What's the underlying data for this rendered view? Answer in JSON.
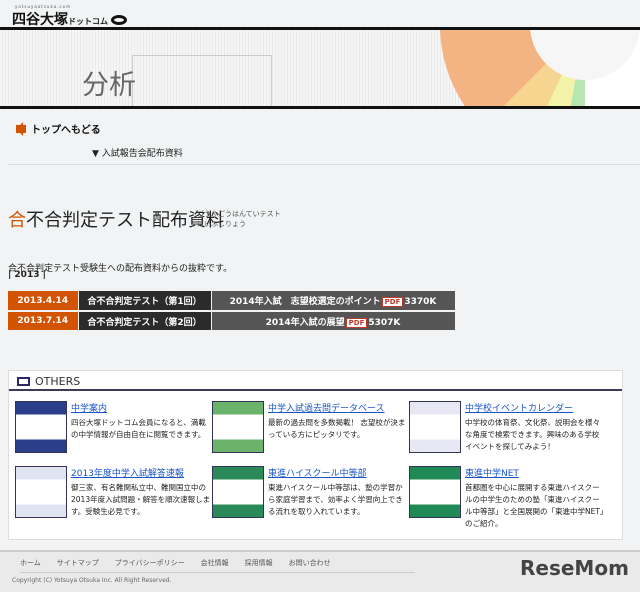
{
  "header": {
    "logo_sub": "yotsuyaotsuka.com",
    "logo_main": "四谷大塚",
    "logo_dot": "ドットコム"
  },
  "banner": {
    "title": "分析"
  },
  "nav": {
    "back": "トップへもどる",
    "breadcrumb": "▼ 入試報告会配布資料"
  },
  "page": {
    "title_first": "合",
    "title_rest": "不合判定テスト配布資料",
    "ruby1": "ごうふごうはんていテスト",
    "ruby2": "はいふしりょう",
    "desc": "合不合判定テスト受験生への配布資料からの抜粋です。",
    "year": "| 2013 |"
  },
  "rows": [
    {
      "date": "2013.4.14",
      "name": "合不合判定テスト（第1回）",
      "link": "2014年入試　志望校選定のポイント",
      "pdf": "PDF",
      "size": "3370K"
    },
    {
      "date": "2013.7.14",
      "name": "合不合判定テスト（第2回）",
      "link": "2014年入試の展望",
      "pdf": "PDF",
      "size": "5307K"
    }
  ],
  "others": {
    "heading": "OTHERS",
    "items": [
      {
        "title": "中学案内",
        "text": "四谷大塚ドットコム会員になると、満載の中学情報が自由自在に閲覧できます。",
        "color": "#2a3e8a"
      },
      {
        "title": "中学入試過去問データベース",
        "text": "最新の過去問を多数掲載！ 志望校が決まっている方にピッタリです。",
        "color": "#6bb36b"
      },
      {
        "title": "中学校イベントカレンダー",
        "text": "中学校の体育祭、文化祭、説明会を様々な角度で検索できます。興味のある学校イベントを探してみよう！",
        "color": "#e8e8f4"
      },
      {
        "title": "2013年度中学入試解答速報",
        "text": "御三家、有名難関私立中、難関国立中の2013年度入試問題・解答を順次速報します。受験生必見です。",
        "color": "#dfe3f2"
      },
      {
        "title": "東進ハイスクール中等部",
        "text": "東進ハイスクール中等部は、塾の学習から家庭学習まで、効率よく学習向上できる流れを取り入れています。",
        "color": "#2a8a5a"
      },
      {
        "title": "東進中学NET",
        "text": "首都圏を中心に展開する東進ハイスクールの中学生のための塾「東進ハイスクール中等部」と全国展開の「東進中学NET」のご紹介。",
        "color": "#1f8a55"
      }
    ]
  },
  "footer": {
    "links": [
      "ホーム",
      "サイトマップ",
      "プライバシーポリシー",
      "会社情報",
      "採用情報",
      "お問い合わせ"
    ],
    "copyright": "Copyright (C) Yotsuya Otsuka Inc. All Right Reserved.",
    "watermark": "ReseMom"
  }
}
